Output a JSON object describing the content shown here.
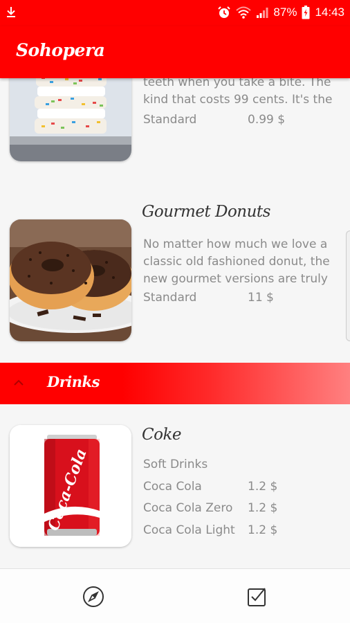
{
  "status_bar": {
    "battery": "87%",
    "time": "14:43",
    "icons": [
      "download-icon",
      "alarm-icon",
      "wifi-icon",
      "signal-icon",
      "battery-icon"
    ]
  },
  "app": {
    "title": "Sohopera",
    "brand_color": "#ff0000"
  },
  "menu": {
    "items": [
      {
        "desc_lines": [
          "teeth when you take a bite. The",
          "kind that costs 99 cents. It's the"
        ],
        "prices": [
          {
            "label": "Standard",
            "value": "0.99 $"
          }
        ]
      },
      {
        "name": "Gourmet Donuts",
        "desc_lines": [
          "No matter how much we love a",
          "classic old fashioned donut, the",
          "new gourmet versions are truly"
        ],
        "prices": [
          {
            "label": "Standard",
            "value": "11 $"
          }
        ]
      }
    ],
    "sections": [
      {
        "title": "Drinks",
        "items": [
          {
            "name": "Coke",
            "category": "Soft Drinks",
            "prices": [
              {
                "label": "Coca Cola",
                "value": "1.2 $"
              },
              {
                "label": "Coca Cola Zero",
                "value": "1.2 $"
              },
              {
                "label": "Coca Cola Light",
                "value": "1.2 $"
              }
            ]
          }
        ]
      }
    ]
  },
  "bottom_nav": {
    "items": [
      {
        "icon": "compass-icon"
      },
      {
        "icon": "checkbox-icon"
      }
    ]
  }
}
